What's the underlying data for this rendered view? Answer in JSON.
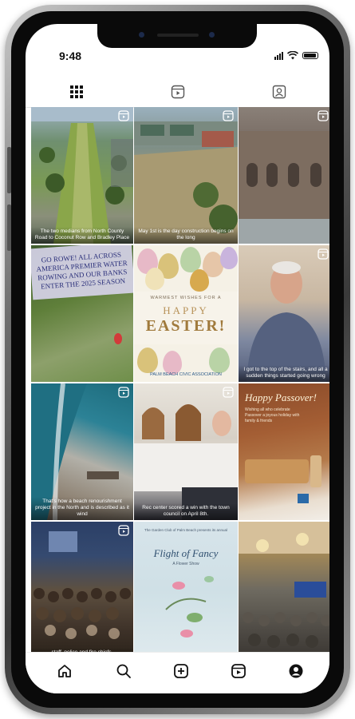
{
  "status_bar": {
    "time": "9:48"
  },
  "tabs": [
    {
      "icon": "grid-icon",
      "active": true
    },
    {
      "icon": "reels-icon",
      "active": false
    },
    {
      "icon": "tagged-icon",
      "active": false
    }
  ],
  "posts": [
    {
      "caption": "The two medians from North County Road to Coconut Row and Bradley Place",
      "reel": true
    },
    {
      "caption": "May 1st is the day construction begins on the long",
      "reel": true
    },
    {
      "caption": "",
      "reel": true
    },
    {
      "caption": "",
      "reel": false,
      "sign_text": "GO ROWE! ALL ACROSS AMERICA PREMIER WATER ROWING AND OUR BANKS ENTER THE 2025 SEASON"
    },
    {
      "caption": "",
      "reel": false,
      "small": "WARMEST WISHES FOR A",
      "happy": "HAPPY",
      "big": "EASTER!",
      "org": "PALM BEACH CIVIC ASSOCIATION"
    },
    {
      "caption": "I got to the top of the stairs, and all a sudden things started going wrong",
      "reel": true
    },
    {
      "caption": "That's how a beach renourishment project in the North and is described as it wind",
      "reel": true
    },
    {
      "caption": "Rec center scored a win with the town council on April 8th.",
      "reel": true
    },
    {
      "caption": "",
      "reel": false,
      "title": "Happy Passover!",
      "sub": "Wishing all who celebrate Passover a joyous holiday with family & friends"
    },
    {
      "caption": "staff, police and fire chiefs,",
      "reel": true
    },
    {
      "caption": "",
      "reel": false,
      "top": "The Garden Club of Palm Beach presents its annual",
      "title": "Flight of Fancy",
      "sub": "A Flower Show"
    },
    {
      "caption": "",
      "reel": false
    }
  ],
  "bottom_nav": [
    "home-icon",
    "search-icon",
    "create-icon",
    "reels-icon",
    "profile-icon"
  ]
}
